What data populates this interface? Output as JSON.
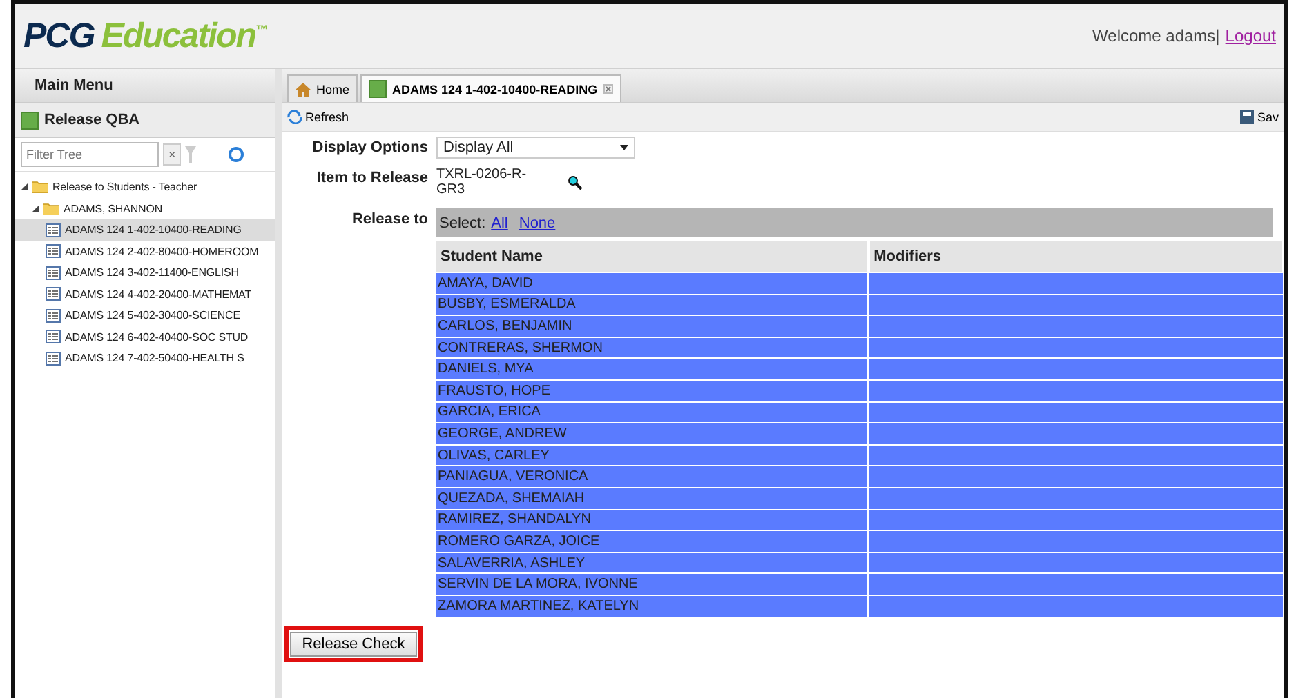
{
  "header": {
    "logo_main": "PCG",
    "logo_accent": "Education",
    "logo_mark": "™",
    "welcome": "Welcome adams|",
    "logout": "Logout"
  },
  "sidebar": {
    "title": "Main Menu",
    "section": "Release QBA",
    "filter": {
      "placeholder": "Filter Tree"
    },
    "clear": "×",
    "tree": [
      {
        "label": "Release to Students - Teacher",
        "kind": "folder",
        "selected": false,
        "children": [
          {
            "label": "ADAMS, SHANNON",
            "kind": "folder",
            "selected": false,
            "children": [
              {
                "label": "ADAMS 124 1-402-10400-READING",
                "kind": "item",
                "selected": true
              },
              {
                "label": "ADAMS 124 2-402-80400-HOMEROOM",
                "kind": "item",
                "selected": false
              },
              {
                "label": "ADAMS 124 3-402-11400-ENGLISH",
                "kind": "item",
                "selected": false
              },
              {
                "label": "ADAMS 124 4-402-20400-MATHEMAT",
                "kind": "item",
                "selected": false
              },
              {
                "label": "ADAMS 124 5-402-30400-SCIENCE",
                "kind": "item",
                "selected": false
              },
              {
                "label": "ADAMS 124 6-402-40400-SOC STUD",
                "kind": "item",
                "selected": false
              },
              {
                "label": "ADAMS 124 7-402-50400-HEALTH S",
                "kind": "item",
                "selected": false
              }
            ]
          }
        ]
      }
    ]
  },
  "tabs": [
    {
      "label": "Home",
      "kind": "home",
      "selected": false
    },
    {
      "label": "ADAMS 124 1-402-10400-READING",
      "kind": "doc",
      "selected": true
    }
  ],
  "toolbar": {
    "refresh": "Refresh",
    "save": "Sav"
  },
  "form": {
    "display_label": "Display Options",
    "display_value": "Display All",
    "item_label": "Item to Release",
    "item_value": "TXRL-0206-R-\nGR3",
    "release_label": "Release to",
    "select_label": "Select:",
    "select_all": "All",
    "select_none": "None"
  },
  "table": {
    "columns": [
      "Student Name",
      "Modifiers"
    ],
    "rows": [
      {
        "name": "AMAYA, DAVID",
        "selected": true
      },
      {
        "name": "BUSBY, ESMERALDA",
        "selected": true
      },
      {
        "name": "CARLOS, BENJAMIN",
        "selected": true
      },
      {
        "name": "CONTRERAS, SHERMON",
        "selected": true
      },
      {
        "name": "DANIELS, MYA",
        "selected": true
      },
      {
        "name": "FRAUSTO, HOPE",
        "selected": true
      },
      {
        "name": "GARCIA, ERICA",
        "selected": true
      },
      {
        "name": "GEORGE, ANDREW",
        "selected": true
      },
      {
        "name": "OLIVAS, CARLEY",
        "selected": true
      },
      {
        "name": "PANIAGUA, VERONICA",
        "selected": true
      },
      {
        "name": "QUEZADA, SHEMAIAH",
        "selected": true
      },
      {
        "name": "RAMIREZ, SHANDALYN",
        "selected": true
      },
      {
        "name": "ROMERO GARZA, JOICE",
        "selected": true
      },
      {
        "name": "SALAVERRIA, ASHLEY",
        "selected": true
      },
      {
        "name": "SERVIN DE LA MORA, IVONNE",
        "selected": true
      },
      {
        "name": "ZAMORA MARTINEZ, KATELYN",
        "selected": true
      }
    ]
  },
  "release_button": {
    "label": "Release Check",
    "highlighted": true
  }
}
